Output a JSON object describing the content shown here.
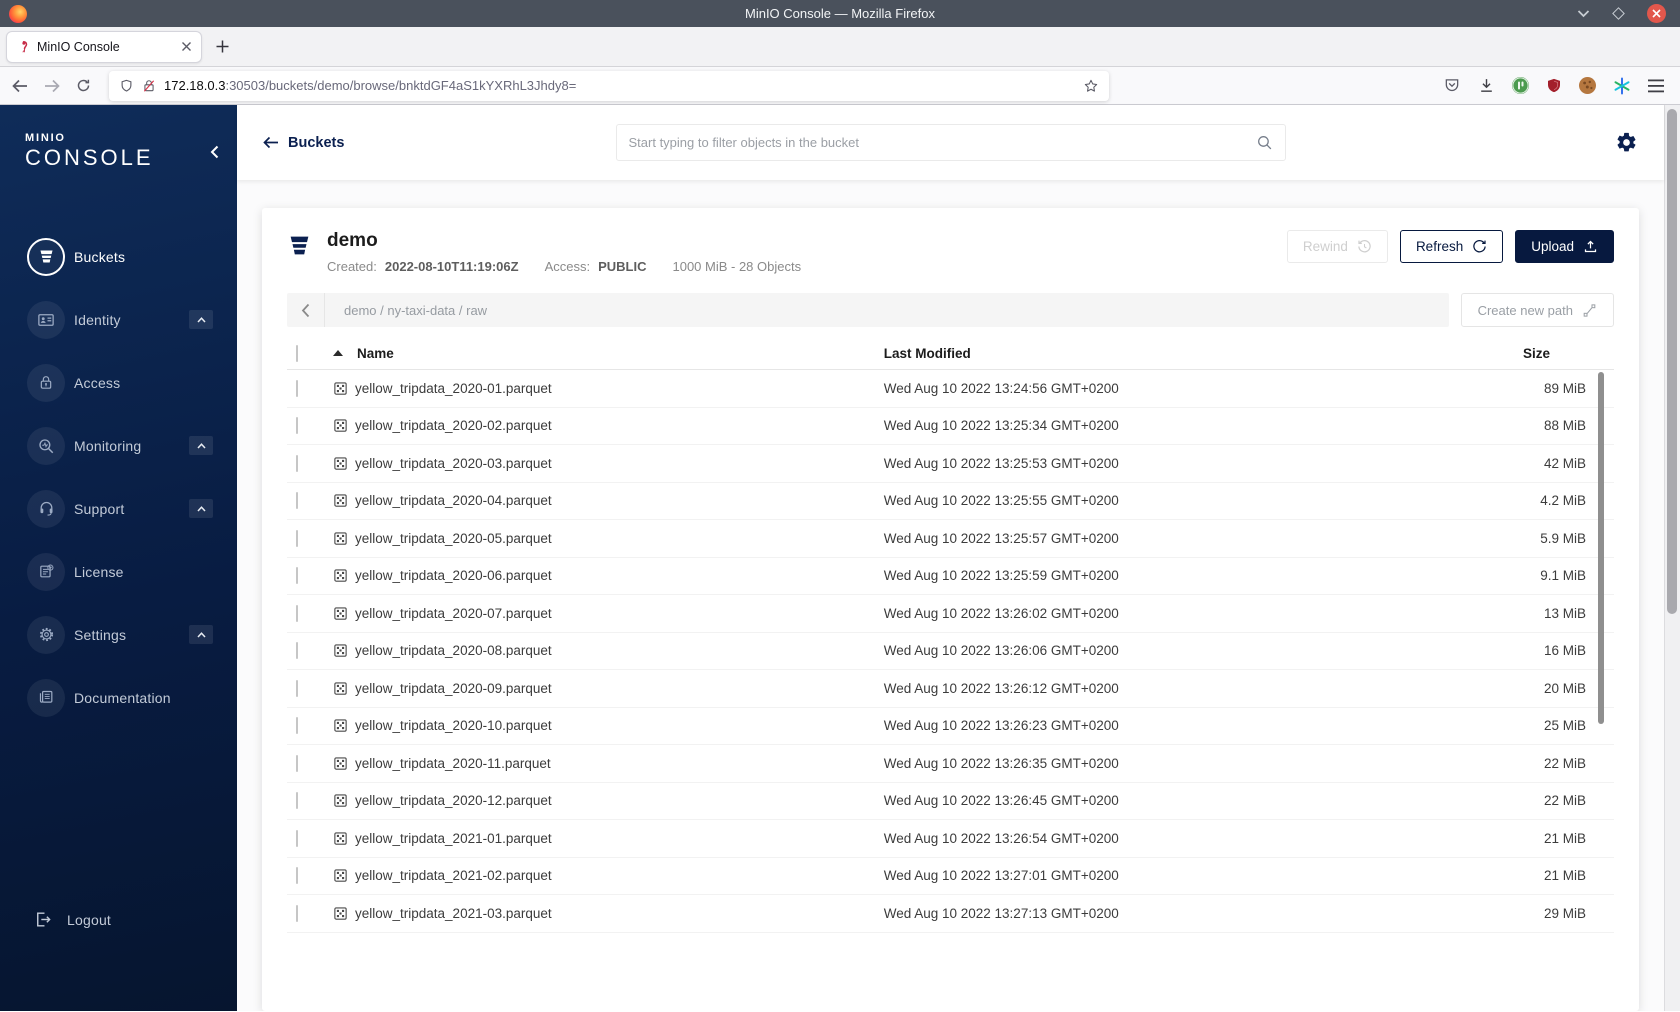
{
  "browser": {
    "window_title": "MinIO Console — Mozilla Firefox",
    "tab_title": "MinIO Console",
    "url_host": "172.18.0.3",
    "url_rest": ":30503/buckets/demo/browse/bnktdGF4aS1kYXRhL3Jhdy8="
  },
  "sidebar": {
    "logo_small": "MINIO",
    "logo_large": "CONSOLE",
    "items": [
      {
        "label": "Buckets",
        "icon": "bucket",
        "active": true,
        "expandable": false
      },
      {
        "label": "Identity",
        "icon": "id-card",
        "active": false,
        "expandable": true
      },
      {
        "label": "Access",
        "icon": "lock",
        "active": false,
        "expandable": false
      },
      {
        "label": "Monitoring",
        "icon": "magnifier-pulse",
        "active": false,
        "expandable": true
      },
      {
        "label": "Support",
        "icon": "headset",
        "active": false,
        "expandable": true
      },
      {
        "label": "License",
        "icon": "document-check",
        "active": false,
        "expandable": false
      },
      {
        "label": "Settings",
        "icon": "gear",
        "active": false,
        "expandable": true
      },
      {
        "label": "Documentation",
        "icon": "book",
        "active": false,
        "expandable": false
      }
    ],
    "logout_label": "Logout"
  },
  "header": {
    "back_label": "Buckets",
    "search_placeholder": "Start typing to filter objects in the bucket"
  },
  "bucket": {
    "name": "demo",
    "created_label": "Created:",
    "created_value": "2022-08-10T11:19:06Z",
    "access_label": "Access:",
    "access_value": "PUBLIC",
    "usage": "1000 MiB - 28 Objects",
    "rewind_label": "Rewind",
    "refresh_label": "Refresh",
    "upload_label": "Upload"
  },
  "browse": {
    "path": "demo / ny-taxi-data / raw",
    "create_path_label": "Create new path"
  },
  "table": {
    "col_name": "Name",
    "col_modified": "Last Modified",
    "col_size": "Size",
    "rows": [
      {
        "name": "yellow_tripdata_2020-01.parquet",
        "modified": "Wed Aug 10 2022 13:24:56 GMT+0200",
        "size": "89 MiB"
      },
      {
        "name": "yellow_tripdata_2020-02.parquet",
        "modified": "Wed Aug 10 2022 13:25:34 GMT+0200",
        "size": "88 MiB"
      },
      {
        "name": "yellow_tripdata_2020-03.parquet",
        "modified": "Wed Aug 10 2022 13:25:53 GMT+0200",
        "size": "42 MiB"
      },
      {
        "name": "yellow_tripdata_2020-04.parquet",
        "modified": "Wed Aug 10 2022 13:25:55 GMT+0200",
        "size": "4.2 MiB"
      },
      {
        "name": "yellow_tripdata_2020-05.parquet",
        "modified": "Wed Aug 10 2022 13:25:57 GMT+0200",
        "size": "5.9 MiB"
      },
      {
        "name": "yellow_tripdata_2020-06.parquet",
        "modified": "Wed Aug 10 2022 13:25:59 GMT+0200",
        "size": "9.1 MiB"
      },
      {
        "name": "yellow_tripdata_2020-07.parquet",
        "modified": "Wed Aug 10 2022 13:26:02 GMT+0200",
        "size": "13 MiB"
      },
      {
        "name": "yellow_tripdata_2020-08.parquet",
        "modified": "Wed Aug 10 2022 13:26:06 GMT+0200",
        "size": "16 MiB"
      },
      {
        "name": "yellow_tripdata_2020-09.parquet",
        "modified": "Wed Aug 10 2022 13:26:12 GMT+0200",
        "size": "20 MiB"
      },
      {
        "name": "yellow_tripdata_2020-10.parquet",
        "modified": "Wed Aug 10 2022 13:26:23 GMT+0200",
        "size": "25 MiB"
      },
      {
        "name": "yellow_tripdata_2020-11.parquet",
        "modified": "Wed Aug 10 2022 13:26:35 GMT+0200",
        "size": "22 MiB"
      },
      {
        "name": "yellow_tripdata_2020-12.parquet",
        "modified": "Wed Aug 10 2022 13:26:45 GMT+0200",
        "size": "22 MiB"
      },
      {
        "name": "yellow_tripdata_2021-01.parquet",
        "modified": "Wed Aug 10 2022 13:26:54 GMT+0200",
        "size": "21 MiB"
      },
      {
        "name": "yellow_tripdata_2021-02.parquet",
        "modified": "Wed Aug 10 2022 13:27:01 GMT+0200",
        "size": "21 MiB"
      },
      {
        "name": "yellow_tripdata_2021-03.parquet",
        "modified": "Wed Aug 10 2022 13:27:13 GMT+0200",
        "size": "29 MiB"
      }
    ]
  },
  "colors": {
    "accent_navy": "#07193F",
    "sidebar_gradient_top": "#0F2C59",
    "close_button_red": "#E2574C",
    "breadcrumb_bg": "#F5F5F5"
  }
}
